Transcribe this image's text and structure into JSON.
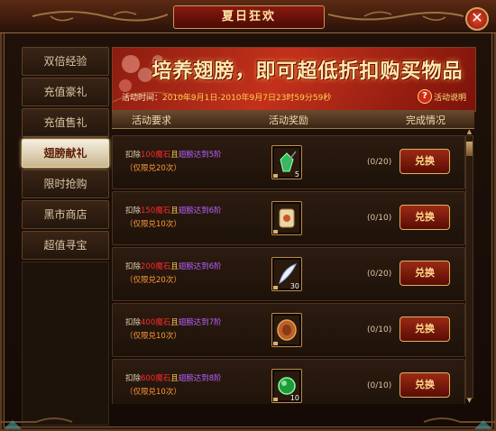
{
  "window": {
    "title": "夏日狂欢",
    "close_label": "✕"
  },
  "sidebar": {
    "items": [
      {
        "label": "双倍经验",
        "active": false
      },
      {
        "label": "充值豪礼",
        "active": false
      },
      {
        "label": "充值售礼",
        "active": false
      },
      {
        "label": "翅膀献礼",
        "active": true
      },
      {
        "label": "限时抢购",
        "active": false
      },
      {
        "label": "黑市商店",
        "active": false
      },
      {
        "label": "超值寻宝",
        "active": false
      }
    ]
  },
  "banner": {
    "headline": "培养翅膀，即可超低折扣购买物品",
    "time_label": "活动时间：",
    "time_value": "2010年9月1日-2010年9月7日23时59分59秒",
    "help_label": "活动说明",
    "help_icon": "?"
  },
  "table": {
    "headers": {
      "requirement": "活动要求",
      "reward": "活动奖励",
      "status": "完成情况"
    },
    "rows": [
      {
        "pre": "扣除",
        "cost": "100魔石",
        "mid": "且",
        "gift": "翅膀达到5阶",
        "limit": "（仅限兑20次）",
        "item_icon": "green-gem-icon",
        "count": "5",
        "progress": "(0/20)",
        "button": "兑换"
      },
      {
        "pre": "扣除",
        "cost": "150魔石",
        "mid": "且",
        "gift": "翅膀达到6阶",
        "limit": "（仅限兑10次）",
        "item_icon": "scroll-icon",
        "count": "",
        "progress": "(0/10)",
        "button": "兑换"
      },
      {
        "pre": "扣除",
        "cost": "200魔石",
        "mid": "且",
        "gift": "翅膀达到6阶",
        "limit": "（仅限兑20次）",
        "item_icon": "white-feather-icon",
        "count": "30",
        "progress": "(0/20)",
        "button": "兑换"
      },
      {
        "pre": "扣除",
        "cost": "400魔石",
        "mid": "且",
        "gift": "翅膀达到7阶",
        "limit": "（仅限兑10次）",
        "item_icon": "bronze-disc-icon",
        "count": "",
        "progress": "(0/10)",
        "button": "兑换"
      },
      {
        "pre": "扣除",
        "cost": "600魔石",
        "mid": "且",
        "gift": "翅膀达到8阶",
        "limit": "（仅限兑10次）",
        "item_icon": "green-orb-icon",
        "count": "10",
        "progress": "(0/10)",
        "button": "兑换"
      }
    ]
  },
  "colors": {
    "accent": "#c3311c",
    "gold": "#e1b060",
    "active_tab": "#f5efe0"
  }
}
